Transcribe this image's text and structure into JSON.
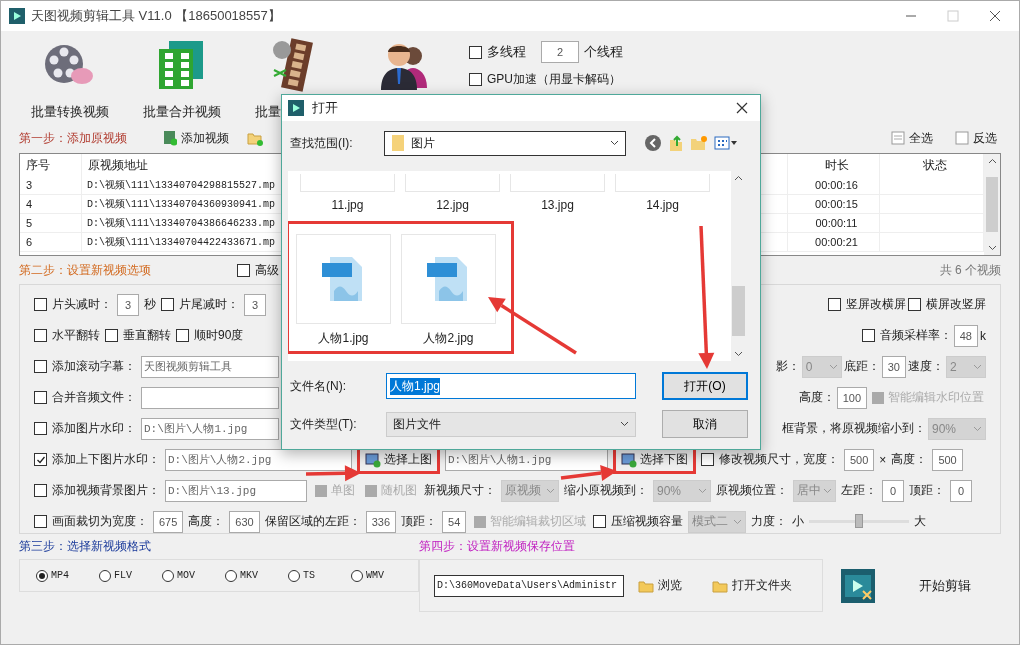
{
  "window": {
    "title": "天图视频剪辑工具 V11.0 【18650018557】"
  },
  "toolbar": [
    {
      "kind": "reel",
      "label": "批量转换视频"
    },
    {
      "kind": "grid",
      "label": "批量合并视频"
    },
    {
      "kind": "film",
      "label": "批量"
    },
    {
      "kind": "people"
    }
  ],
  "threads": {
    "multi": {
      "label": "多线程",
      "checked": false
    },
    "count": "2",
    "unit": "个线程",
    "gpu": {
      "label": "GPU加速（用显卡解码）",
      "checked": false
    }
  },
  "step1": {
    "title": "第一步：添加原视频",
    "add_button": "添加视频",
    "select_all": "全选",
    "invert": "反选"
  },
  "table": {
    "columns": [
      "序号",
      "原视频地址",
      "时长",
      "状态"
    ],
    "rows": [
      {
        "index": "3",
        "path": "D:\\视频\\111\\13340704298815527.mp",
        "duration": "00:00:16"
      },
      {
        "index": "4",
        "path": "D:\\视频\\111\\13340704360930941.mp",
        "duration": "00:00:15"
      },
      {
        "index": "5",
        "path": "D:\\视频\\111\\13340704386646233.mp",
        "duration": "00:00:11"
      },
      {
        "index": "6",
        "path": "D:\\视频\\111\\13340704422433671.mp",
        "duration": "00:00:21"
      }
    ],
    "count": "共 6 个视频"
  },
  "step2": {
    "title": "第二步：设置新视频选项",
    "advanced": {
      "label": "高级",
      "checked": false
    }
  },
  "options": [
    {
      "items": [
        {
          "kind": "check",
          "label": "片头减时：",
          "checked": false
        },
        {
          "kind": "number",
          "value": "3"
        },
        {
          "kind": "label",
          "label": "秒"
        },
        {
          "kind": "check",
          "label": "片尾减时：",
          "checked": false
        },
        {
          "kind": "number",
          "value": "3"
        }
      ],
      "right": [
        {
          "kind": "check",
          "label": "竖屏改横屏",
          "checked": false
        },
        {
          "kind": "check",
          "label": "横屏改竖屏",
          "checked": false
        }
      ]
    },
    {
      "items": [
        {
          "kind": "check",
          "label": "水平翻转",
          "checked": false
        },
        {
          "kind": "check",
          "label": "垂直翻转",
          "checked": false
        },
        {
          "kind": "check",
          "label": "顺时90度",
          "checked": false
        }
      ],
      "right": [
        {
          "kind": "check",
          "label": "音频采样率：",
          "checked": false
        },
        {
          "kind": "number",
          "value": "48"
        },
        {
          "kind": "label",
          "label": "k"
        }
      ]
    },
    {
      "items": [
        {
          "kind": "check",
          "label": "添加滚动字幕：",
          "checked": false
        },
        {
          "kind": "field",
          "value": "天图视频剪辑工具"
        }
      ],
      "right": [
        {
          "kind": "label",
          "label": "影："
        },
        {
          "kind": "select",
          "value": "0",
          "disabled": true
        },
        {
          "kind": "label",
          "label": "底距："
        },
        {
          "kind": "number",
          "value": "30"
        },
        {
          "kind": "label",
          "label": "速度："
        },
        {
          "kind": "select",
          "value": "2",
          "disabled": true
        }
      ]
    },
    {
      "items": [
        {
          "kind": "check",
          "label": "合并音频文件：",
          "checked": false
        },
        {
          "kind": "field"
        }
      ],
      "right": [
        {
          "kind": "label",
          "label": "高度："
        },
        {
          "kind": "number",
          "value": "100"
        },
        {
          "kind": "button",
          "label": "智能编辑水印位置",
          "disabled": true,
          "highlighted": false
        }
      ]
    },
    {
      "items": [
        {
          "kind": "check",
          "label": "添加图片水印：",
          "checked": false
        },
        {
          "kind": "field",
          "value": "D:\\图片\\人物1.jpg"
        }
      ],
      "right": [
        {
          "kind": "label",
          "label": "框背景，将原视频缩小到："
        },
        {
          "kind": "select",
          "value": "90%",
          "disabled": true
        }
      ]
    },
    {
      "items": [
        {
          "kind": "check",
          "label": "添加上下图片水印：",
          "checked": true
        },
        {
          "kind": "field",
          "value": "D:\\图片\\人物2.jpg"
        },
        {
          "kind": "button",
          "label": "选择上图",
          "disabled": false,
          "highlighted": true
        },
        {
          "kind": "field",
          "value": "D:\\图片\\人物1.jpg"
        },
        {
          "kind": "button",
          "label": "选择下图",
          "disabled": false,
          "highlighted": true
        },
        {
          "kind": "check",
          "label": "修改视频尺寸，宽度：",
          "checked": false
        },
        {
          "kind": "number",
          "value": "500"
        },
        {
          "kind": "label",
          "label": "×"
        },
        {
          "kind": "label",
          "label": "高度："
        },
        {
          "kind": "number",
          "value": "500"
        }
      ]
    },
    {
      "items": [
        {
          "kind": "check",
          "label": "添加视频背景图片：",
          "checked": false
        },
        {
          "kind": "field",
          "value": "D:\\图片\\13.jpg"
        },
        {
          "kind": "button",
          "label": "单图",
          "disabled": true,
          "highlighted": false
        },
        {
          "kind": "button",
          "label": "随机图",
          "disabled": true,
          "highlighted": false
        },
        {
          "kind": "label",
          "label": "新视频尺寸："
        },
        {
          "kind": "select",
          "value": "原视频",
          "disabled": true
        },
        {
          "kind": "label",
          "label": "缩小原视频到："
        },
        {
          "kind": "select",
          "value": "90%",
          "disabled": true
        },
        {
          "kind": "label",
          "label": "原视频位置："
        },
        {
          "kind": "select",
          "value": "居中",
          "disabled": true
        },
        {
          "kind": "label",
          "label": "左距："
        },
        {
          "kind": "number",
          "value": "0"
        },
        {
          "kind": "label",
          "label": "顶距："
        },
        {
          "kind": "number",
          "value": "0"
        }
      ]
    },
    {
      "items": [
        {
          "kind": "check",
          "label": "画面裁切为宽度：",
          "checked": false
        },
        {
          "kind": "number",
          "value": "675"
        },
        {
          "kind": "label",
          "label": "高度："
        },
        {
          "kind": "number",
          "value": "630"
        },
        {
          "kind": "label",
          "label": "保留区域的左距："
        },
        {
          "kind": "number",
          "value": "336"
        },
        {
          "kind": "label",
          "label": "顶距："
        },
        {
          "kind": "number",
          "value": "54"
        },
        {
          "kind": "button",
          "label": "智能编辑裁切区域",
          "disabled": true,
          "highlighted": false
        },
        {
          "kind": "check",
          "label": "压缩视频容量",
          "checked": false
        },
        {
          "kind": "select",
          "value": "模式二",
          "disabled": true
        },
        {
          "kind": "label",
          "label": "力度："
        },
        {
          "kind": "label",
          "label": "小"
        },
        {
          "kind": "slider",
          "level": 0.5
        },
        {
          "kind": "label",
          "label": "大"
        }
      ]
    }
  ],
  "step3": {
    "title": "第三步：选择新视频格式",
    "formats": [
      {
        "label": "MP4",
        "selected": true
      },
      {
        "label": "FLV",
        "selected": false
      },
      {
        "label": "MOV",
        "selected": false
      },
      {
        "label": "MKV",
        "selected": false
      },
      {
        "label": "TS",
        "selected": false
      },
      {
        "label": "WMV",
        "selected": false
      }
    ]
  },
  "step4": {
    "title": "第四步：设置新视频保存位置",
    "path": "D:\\360MoveData\\Users\\Administr",
    "browse": "浏览",
    "open_folder": "打开文件夹",
    "start": "开始剪辑"
  },
  "dialog": {
    "title": "打开",
    "look_in_label": "查找范围(I):",
    "look_in": "图片",
    "file_rows": [
      {
        "scrolled_past": true,
        "highlighted": false,
        "files": [
          "11.jpg",
          "12.jpg",
          "13.jpg",
          "14.jpg"
        ]
      },
      {
        "scrolled_past": false,
        "highlighted": true,
        "files": [
          "人物1.jpg",
          "人物2.jpg"
        ]
      }
    ],
    "file_name_label": "文件名(N):",
    "file_name": "人物1.jpg",
    "file_type_label": "文件类型(T):",
    "file_type": "图片文件",
    "buttons": [
      {
        "label": "打开(O)",
        "default": true
      },
      {
        "label": "取消",
        "default": false
      }
    ]
  }
}
